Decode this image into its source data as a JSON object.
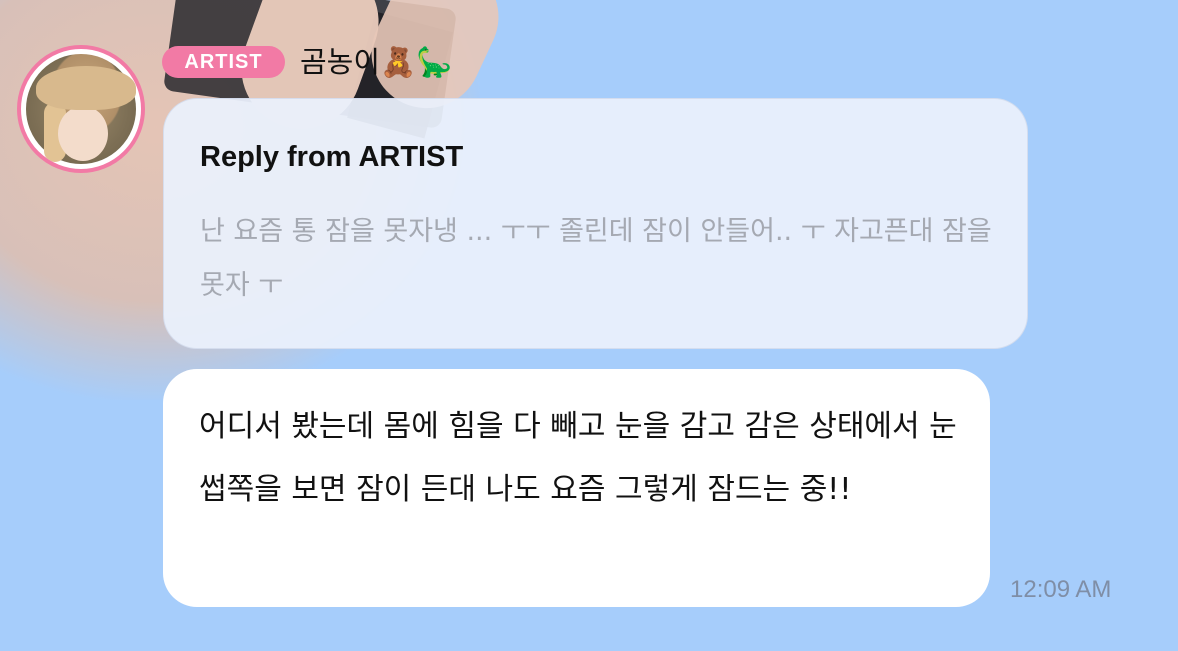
{
  "sender": {
    "badge_label": "ARTIST",
    "nickname": "곰농이🧸🦕",
    "avatar": "artist-avatar-photo"
  },
  "reply": {
    "title": "Reply from ARTIST",
    "quoted_text": "난 요즘 통 잠을 못자냉 ... ㅜㅜ 졸린데 잠이 안들어.. ㅜ 자고픈대 잠을못자 ㅜ"
  },
  "message": {
    "text": "어디서 봤는데 몸에 힘을 다 빼고 눈을 감고 감은 상태에서 눈썹쪽을 보면 잠이 든대 나도 요즘 그렇게 잠드는 중!!",
    "timestamp": "12:09 AM"
  },
  "colors": {
    "background": "#a6cdfb",
    "badge": "#f27aa5",
    "reply_box": "#eaf0fc",
    "message_box": "#ffffff",
    "quoted_text": "#a5a9b2",
    "timestamp": "#7f8ea6"
  }
}
